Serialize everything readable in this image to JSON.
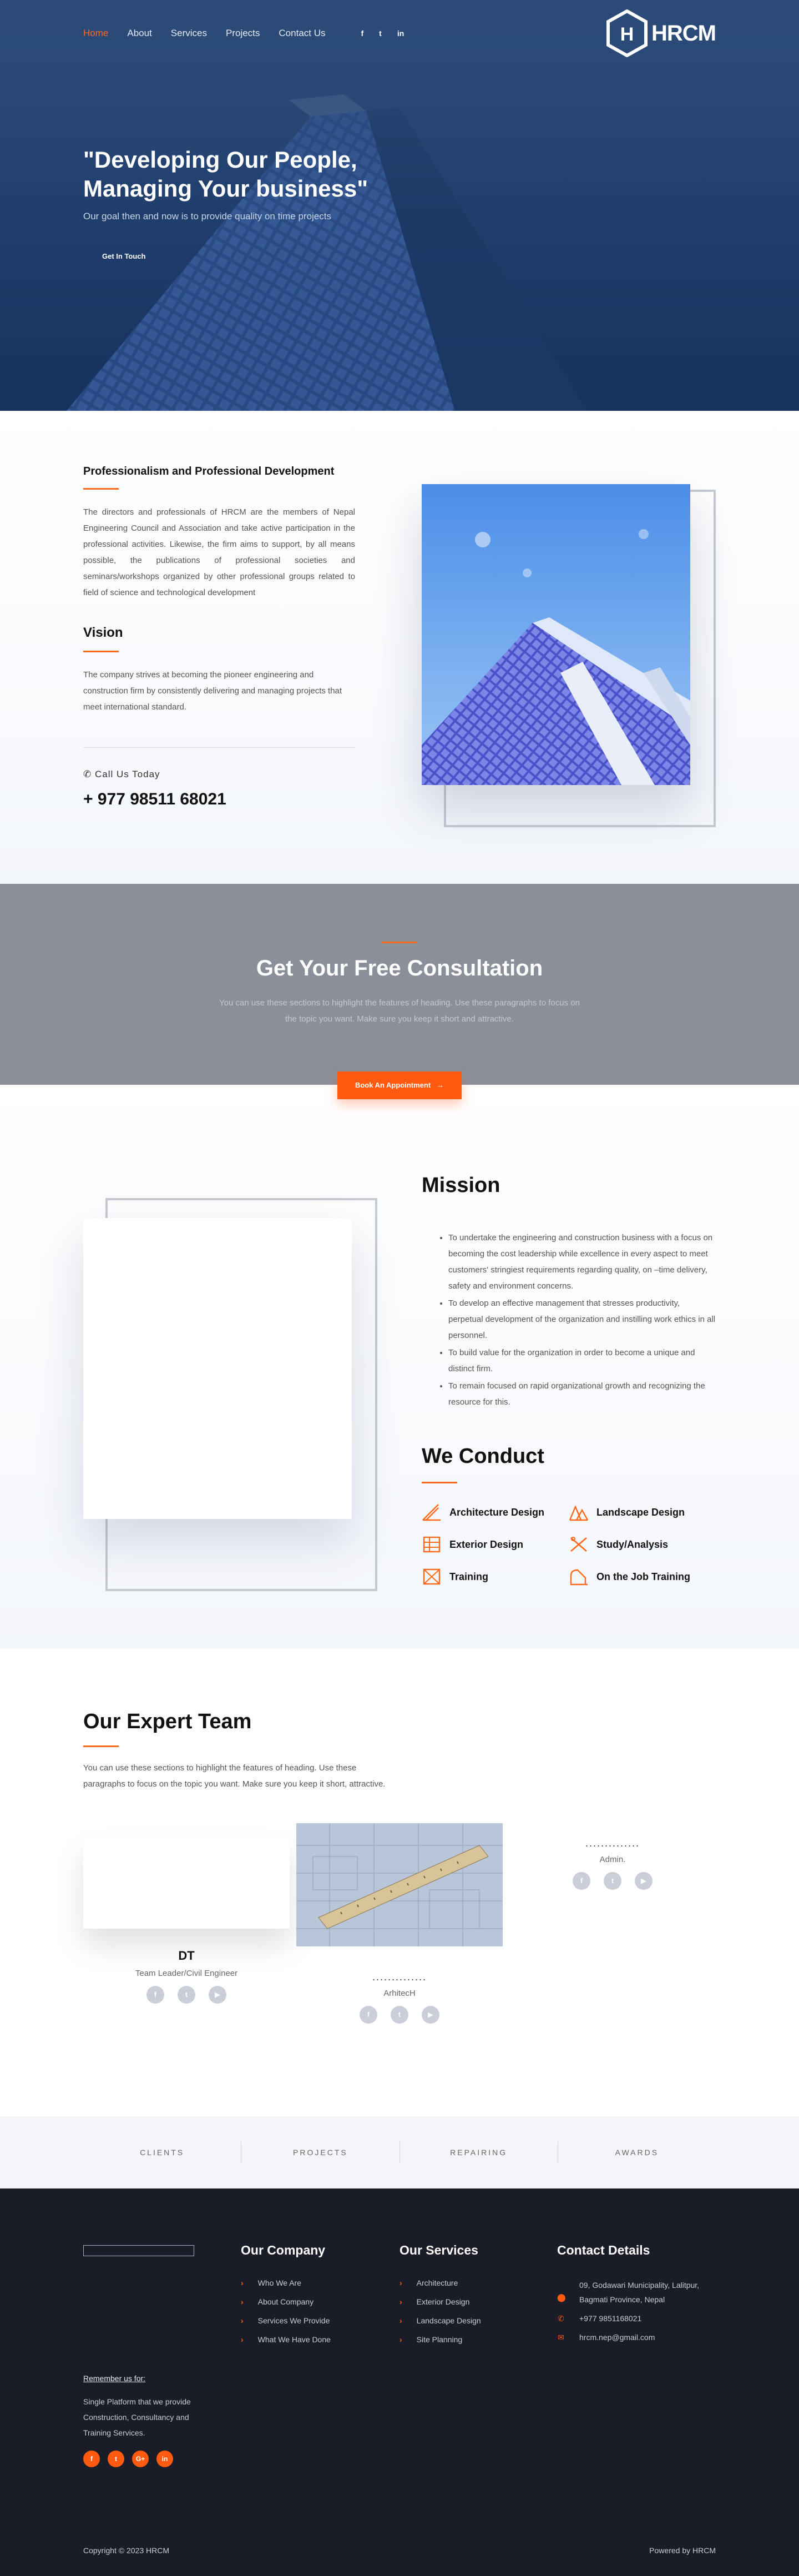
{
  "nav": {
    "links": [
      "Home",
      "About",
      "Services",
      "Projects",
      "Contact Us"
    ],
    "social": [
      "f",
      "t",
      "in"
    ],
    "logo_text": "HRCM",
    "logo_letter": "H"
  },
  "hero": {
    "title": "\"Developing Our People, Managing Your business\"",
    "subtitle": "Our goal then and now is to provide quality on time projects",
    "button": "Get In Touch"
  },
  "about": {
    "heading": "Professionalism and Professional Development",
    "paragraph": "The directors and professionals of HRCM are the members of Nepal Engineering Council and Association and take active participation in the professional activities. Likewise, the firm aims to support, by all means possible, the publications of professional societies and seminars/workshops organized by other professional groups related to field of science and technological development",
    "vision_heading": "Vision",
    "vision_text": "The company strives at becoming the pioneer engineering and construction firm by consistently delivering and managing projects that meet international standard.",
    "call_label": "Call Us Today",
    "call_number": "+ 977 98511 68021"
  },
  "consult": {
    "title": "Get Your Free Consultation",
    "text": "You can use these sections to highlight the features of heading. Use these paragraphs to focus on the topic you want. Make sure you keep it short and attractive.",
    "button": "Book An Appointment"
  },
  "mission": {
    "title": "Mission",
    "items": [
      "To undertake the engineering and construction business with a focus on becoming the cost leadership while excellence in every aspect to meet customers' stringiest requirements regarding quality, on –time delivery, safety and environment concerns.",
      "To develop an effective management that stresses productivity, perpetual development of the organization and instilling work ethics in all personnel.",
      "To build value for the organization in order to become a unique and distinct firm.",
      "To remain focused on rapid organizational growth and recognizing the resource for this."
    ],
    "conduct_title": "We Conduct",
    "conduct": [
      {
        "label": "Architecture Design",
        "icon": "architecture-icon"
      },
      {
        "label": "Landscape Design",
        "icon": "landscape-icon"
      },
      {
        "label": "Exterior Design",
        "icon": "exterior-icon"
      },
      {
        "label": "Study/Analysis",
        "icon": "analysis-icon"
      },
      {
        "label": "Training",
        "icon": "training-icon"
      },
      {
        "label": "On the Job Training",
        "icon": "job-training-icon"
      }
    ]
  },
  "team": {
    "title": "Our Expert Team",
    "text": "You can use these sections to highlight the features of heading. Use these paragraphs to focus on the topic you want. Make sure you keep it short, attractive.",
    "members": [
      {
        "name": "DT",
        "role": "Team Leader/Civil Engineer"
      },
      {
        "name": "..............",
        "role": "ArhitecH"
      },
      {
        "name": "..............",
        "role": "Admin."
      }
    ]
  },
  "strip": [
    "CLIENTS",
    "PROJECTS",
    "REPAIRING",
    "AWARDS"
  ],
  "footer": {
    "remember": "Remember us for:",
    "desc": "Single Platform that we provide Construction, Consultancy and Training Services.",
    "social": [
      "f",
      "t",
      "G+",
      "in"
    ],
    "company_title": "Our Company",
    "company_links": [
      "Who We Are",
      "About Company",
      "Services We Provide",
      "What We Have Done"
    ],
    "services_title": "Our Services",
    "services_links": [
      "Architecture",
      "Exterior Design",
      "Landscape Design",
      "Site Planning"
    ],
    "contact_title": "Contact Details",
    "address": "09, Godawari Municipality, Lalitpur, Bagmati Province, Nepal",
    "phone": "+977 9851168021",
    "email": "hrcm.nep@gmail.com",
    "copyright": "Copyright © 2023 HRCM",
    "powered": "Powered by HRCM"
  },
  "colors": {
    "accent": "#ff6a1a",
    "hero": "#1f3d6c",
    "footer": "#1a1d27",
    "consult": "#8a8f99"
  }
}
